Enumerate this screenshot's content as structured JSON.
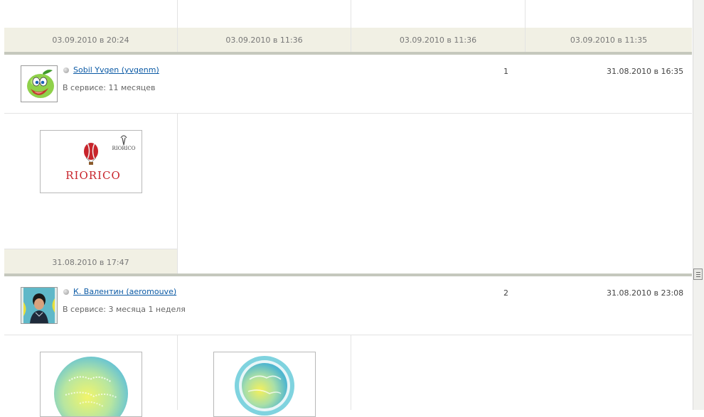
{
  "top_row": {
    "dates": [
      "03.09.2010 в 20:24",
      "03.09.2010 в 11:36",
      "03.09.2010 в 11:36",
      "03.09.2010 в 11:35"
    ]
  },
  "entries": [
    {
      "username": "Sobil Yvgen (yvgenm)",
      "service_time": "В сервисе: 11 месяцев",
      "count": "1",
      "posted": "31.08.2010 в 16:35",
      "thumb_dates": [
        "31.08.2010 в 17:47"
      ],
      "logo_text": "RIORICO",
      "logo_small_text": "RIORICO"
    },
    {
      "username": "К. Валентин (aeromouve)",
      "service_time": "В сервисе: 3 месяца 1 неделя",
      "count": "2",
      "posted": "31.08.2010 в 23:08"
    }
  ]
}
